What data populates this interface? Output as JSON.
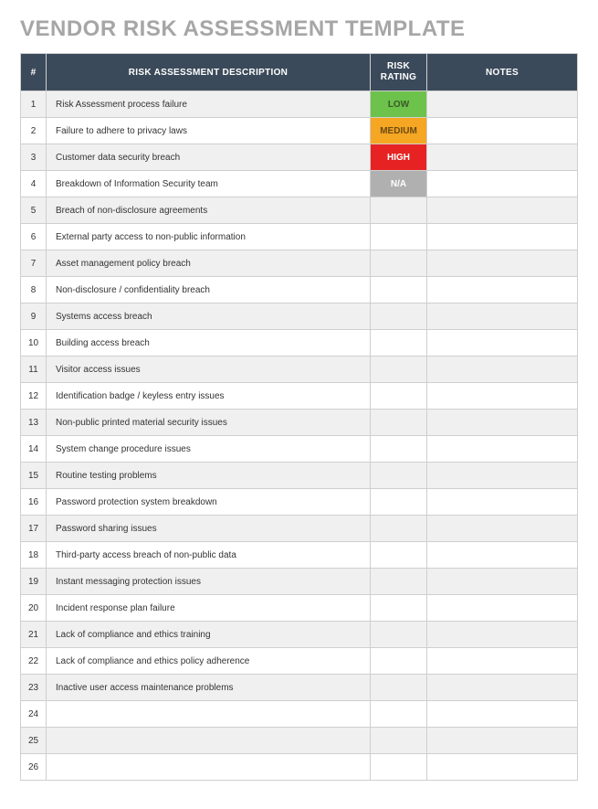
{
  "title": "VENDOR RISK ASSESSMENT TEMPLATE",
  "headers": {
    "num": "#",
    "desc": "RISK ASSESSMENT DESCRIPTION",
    "rating": "RISK RATING",
    "notes": "NOTES"
  },
  "ratings": {
    "LOW": {
      "label": "LOW",
      "class": "rating-low"
    },
    "MEDIUM": {
      "label": "MEDIUM",
      "class": "rating-medium"
    },
    "HIGH": {
      "label": "HIGH",
      "class": "rating-high"
    },
    "NA": {
      "label": "N/A",
      "class": "rating-na"
    }
  },
  "rows": [
    {
      "num": "1",
      "desc": "Risk Assessment process failure",
      "rating": "LOW",
      "notes": ""
    },
    {
      "num": "2",
      "desc": "Failure to adhere to privacy laws",
      "rating": "MEDIUM",
      "notes": ""
    },
    {
      "num": "3",
      "desc": "Customer data security breach",
      "rating": "HIGH",
      "notes": ""
    },
    {
      "num": "4",
      "desc": "Breakdown of Information Security team",
      "rating": "NA",
      "notes": ""
    },
    {
      "num": "5",
      "desc": "Breach of non-disclosure agreements",
      "rating": "",
      "notes": ""
    },
    {
      "num": "6",
      "desc": "External party access to non-public information",
      "rating": "",
      "notes": ""
    },
    {
      "num": "7",
      "desc": "Asset management policy breach",
      "rating": "",
      "notes": ""
    },
    {
      "num": "8",
      "desc": "Non-disclosure / confidentiality breach",
      "rating": "",
      "notes": ""
    },
    {
      "num": "9",
      "desc": "Systems access breach",
      "rating": "",
      "notes": ""
    },
    {
      "num": "10",
      "desc": "Building access breach",
      "rating": "",
      "notes": ""
    },
    {
      "num": "11",
      "desc": "Visitor access issues",
      "rating": "",
      "notes": ""
    },
    {
      "num": "12",
      "desc": "Identification badge / keyless entry issues",
      "rating": "",
      "notes": ""
    },
    {
      "num": "13",
      "desc": "Non-public printed material security issues",
      "rating": "",
      "notes": ""
    },
    {
      "num": "14",
      "desc": "System change procedure issues",
      "rating": "",
      "notes": ""
    },
    {
      "num": "15",
      "desc": "Routine testing problems",
      "rating": "",
      "notes": ""
    },
    {
      "num": "16",
      "desc": "Password protection system breakdown",
      "rating": "",
      "notes": ""
    },
    {
      "num": "17",
      "desc": "Password sharing issues",
      "rating": "",
      "notes": ""
    },
    {
      "num": "18",
      "desc": "Third-party access breach of non-public data",
      "rating": "",
      "notes": ""
    },
    {
      "num": "19",
      "desc": "Instant messaging protection issues",
      "rating": "",
      "notes": ""
    },
    {
      "num": "20",
      "desc": "Incident response plan failure",
      "rating": "",
      "notes": ""
    },
    {
      "num": "21",
      "desc": "Lack of compliance and ethics training",
      "rating": "",
      "notes": ""
    },
    {
      "num": "22",
      "desc": "Lack of compliance and ethics policy adherence",
      "rating": "",
      "notes": ""
    },
    {
      "num": "23",
      "desc": "Inactive user access maintenance problems",
      "rating": "",
      "notes": ""
    },
    {
      "num": "24",
      "desc": "",
      "rating": "",
      "notes": ""
    },
    {
      "num": "25",
      "desc": "",
      "rating": "",
      "notes": ""
    },
    {
      "num": "26",
      "desc": "",
      "rating": "",
      "notes": ""
    }
  ]
}
